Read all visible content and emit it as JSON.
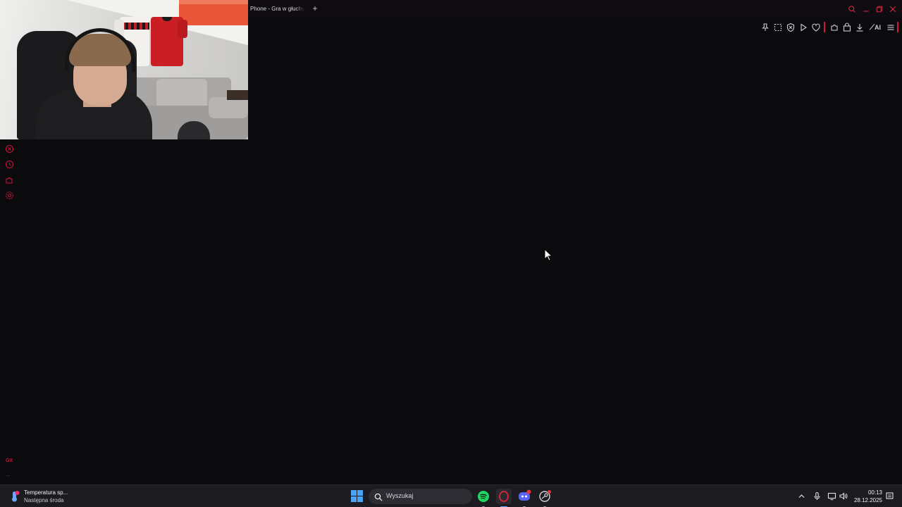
{
  "browser": {
    "tab_title": "Phone - Gra w głuchy telefon",
    "new_tab_label": "+",
    "toolbar": {
      "ai_label": "AI"
    }
  },
  "colors": {
    "accent": "#d4163a",
    "background": "#0b0a0c",
    "taskbar": "#1c1b20"
  },
  "sidebar": {
    "items": [
      {
        "icon": "close-circle-icon"
      },
      {
        "icon": "history-clock-icon"
      },
      {
        "icon": "extensions-icon"
      },
      {
        "icon": "settings-gear-icon"
      }
    ],
    "gx_label": "GX",
    "more_label": "···"
  },
  "taskbar": {
    "weather": {
      "title": "Temperatura sp...",
      "subtitle": "Następna środa"
    },
    "search_placeholder": "Wyszukaj",
    "apps": [
      "spotify-icon",
      "opera-gx-icon",
      "discord-icon",
      "steam-icon"
    ],
    "clock": {
      "time": "00:13",
      "date": "28.12.2025"
    }
  }
}
